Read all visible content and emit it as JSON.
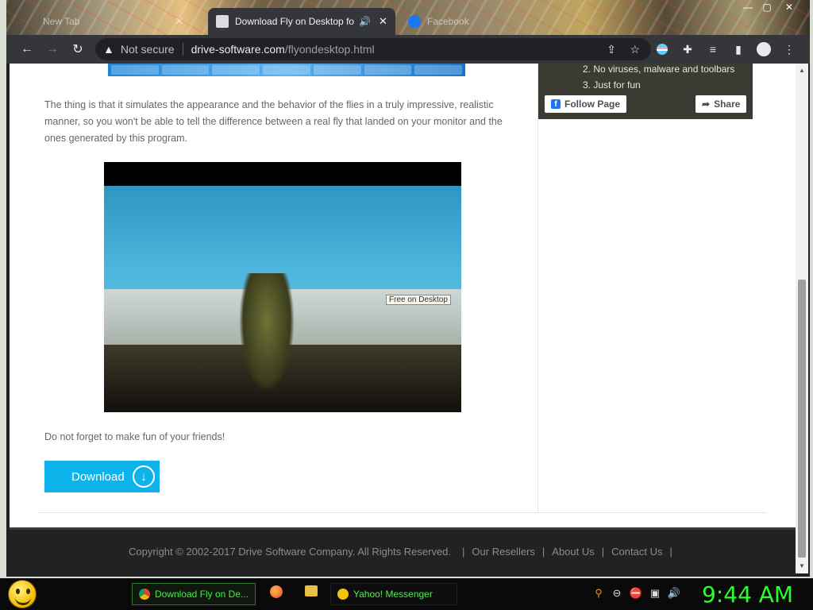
{
  "browser": {
    "tabs": [
      {
        "title": "New Tab",
        "active": false
      },
      {
        "title": "Download Fly on Desktop fo",
        "active": true
      },
      {
        "title": "Facebook",
        "active": false
      }
    ],
    "address": {
      "security": "Not secure",
      "domain": "drive-software.com",
      "path": "/flyondesktop.html"
    }
  },
  "article": {
    "paragraph": "The thing is that it simulates the appearance and the behavior of the flies in a truly impressive, realistic manner, so you won't be able to tell the difference between a real fly that landed on your monitor and the ones generated by this program.",
    "video_tooltip": "Free on Desktop",
    "caption": "Do not forget to make fun of your friends!",
    "download_label": "Download"
  },
  "facebook_widget": {
    "list_items": [
      "2. No viruses, malware and toolbars",
      "3. Just for fun"
    ],
    "follow_label": "Follow Page",
    "share_label": "Share"
  },
  "footer": {
    "copyright": "Copyright © 2002-2017 Drive Software Company. All Rights Reserved.",
    "links": [
      "Our Resellers",
      "About Us",
      "Contact Us"
    ]
  },
  "taskbar": {
    "items": [
      "Download Fly on De...",
      "Yahoo! Messenger"
    ],
    "clock": "9:44 AM"
  }
}
